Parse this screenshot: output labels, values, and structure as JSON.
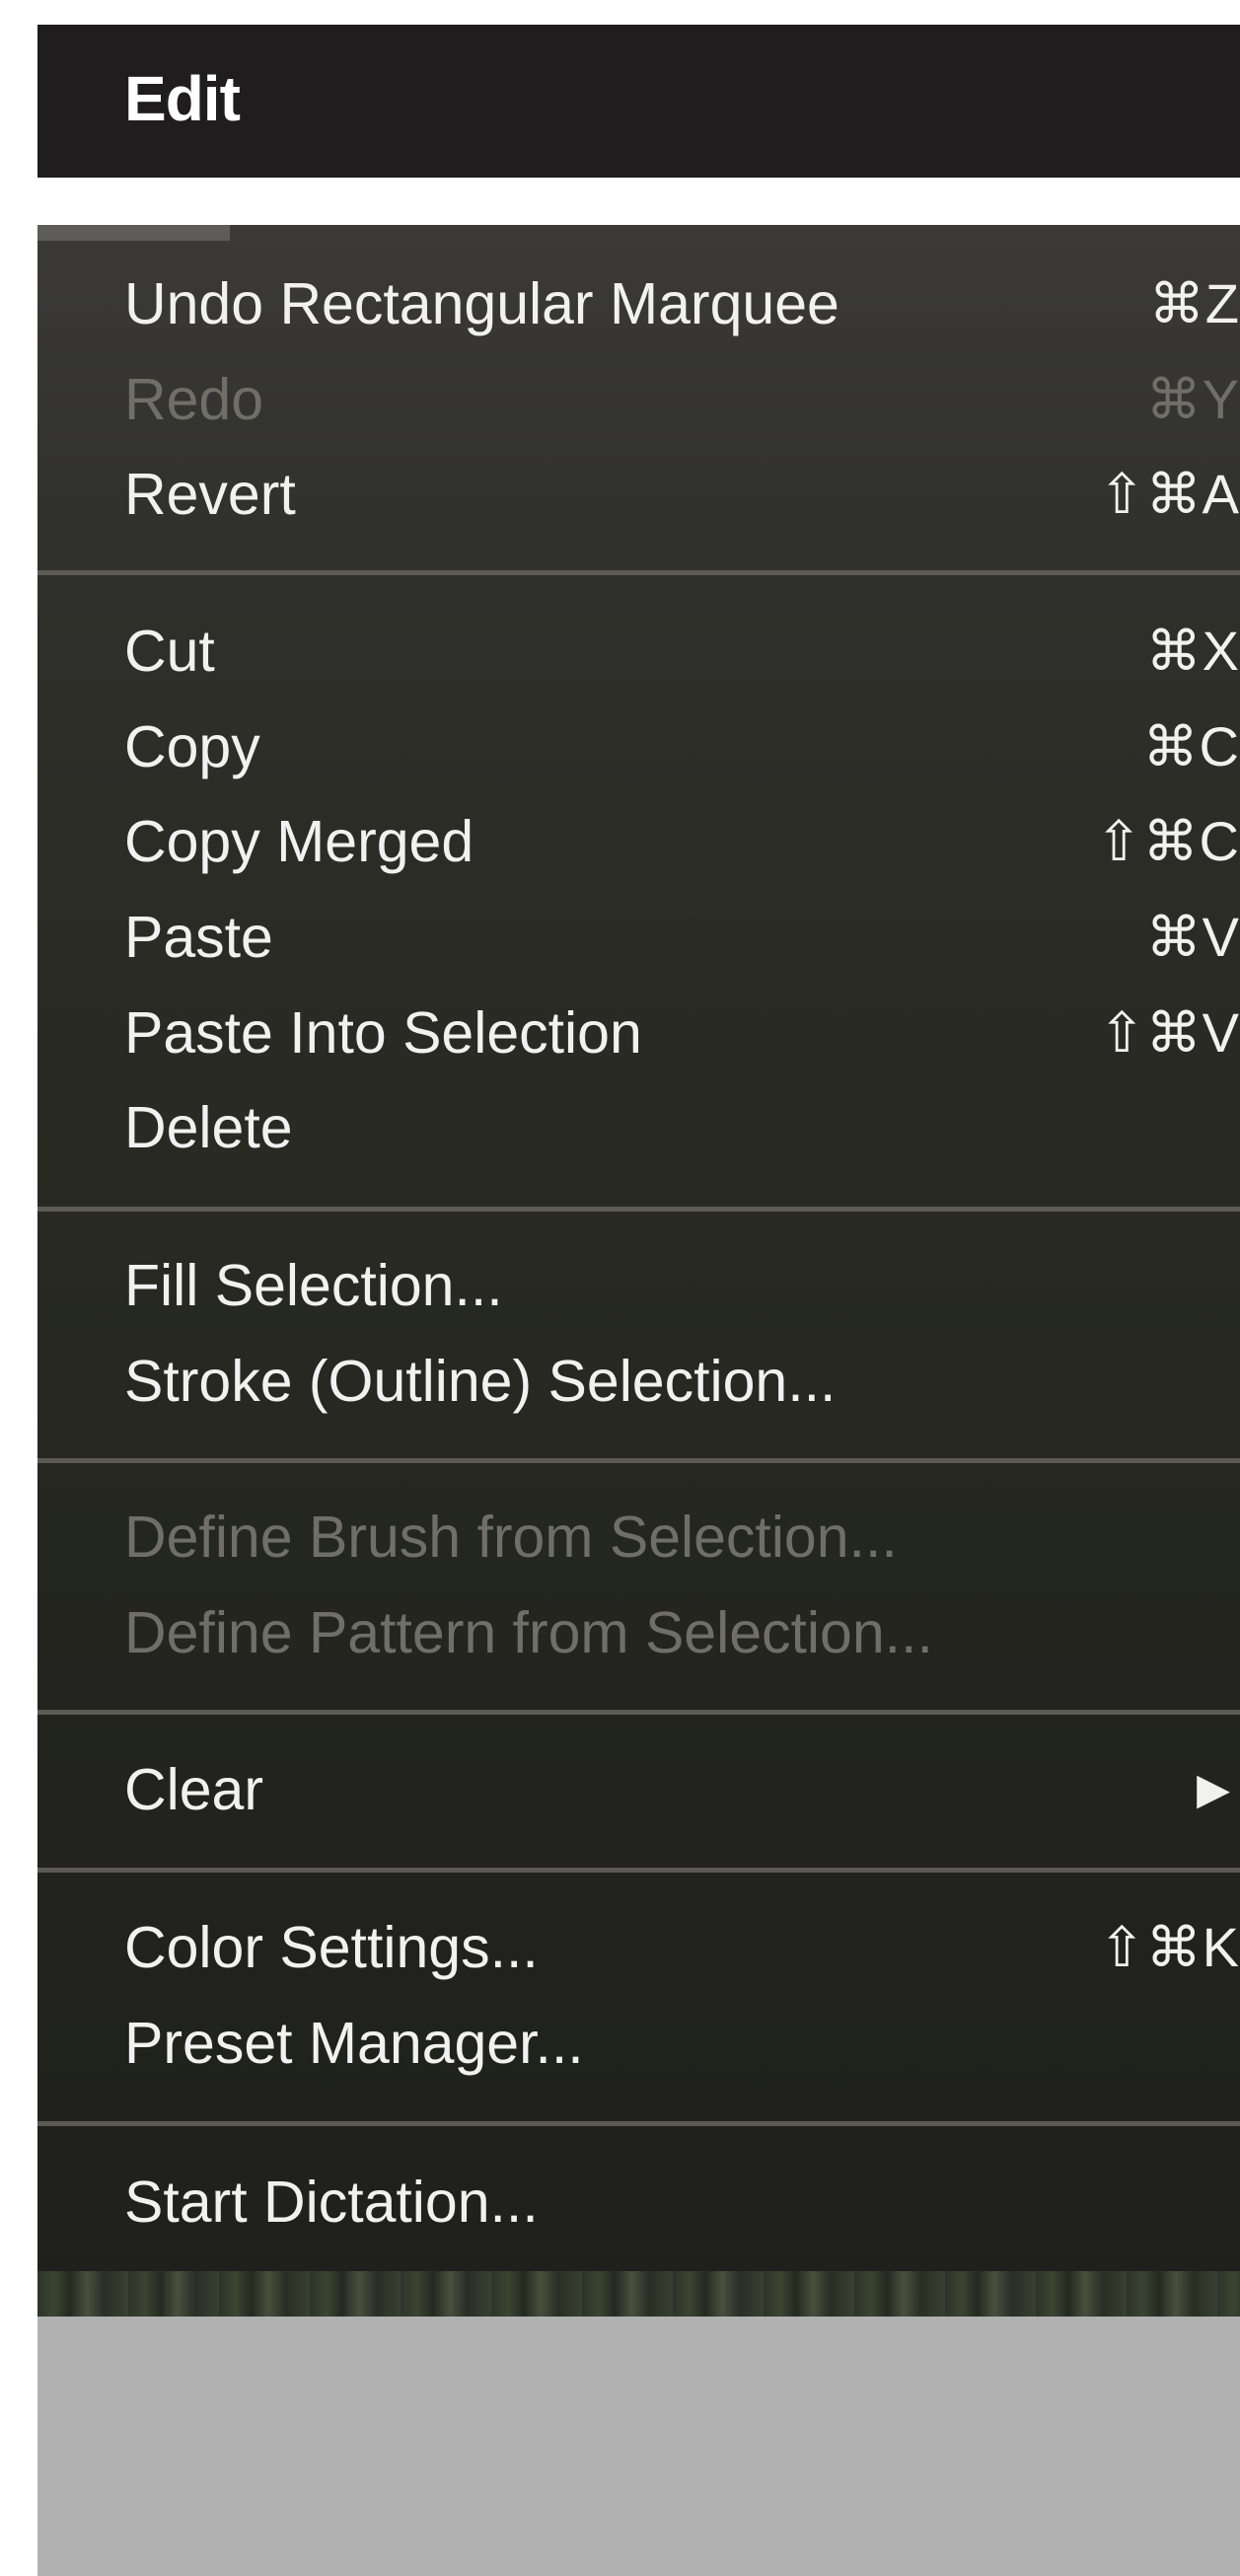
{
  "menu_bar": {
    "title": "Edit"
  },
  "menu": {
    "items": [
      {
        "label": "Undo Rectangular Marquee",
        "shortcut": "⌘Z",
        "disabled": false
      },
      {
        "label": "Redo",
        "shortcut": "⌘Y",
        "disabled": true
      },
      {
        "label": "Revert",
        "shortcut": "⇧⌘A",
        "disabled": false
      },
      {
        "label": "Cut",
        "shortcut": "⌘X",
        "disabled": false
      },
      {
        "label": "Copy",
        "shortcut": "⌘C",
        "disabled": false
      },
      {
        "label": "Copy Merged",
        "shortcut": "⇧⌘C",
        "disabled": false
      },
      {
        "label": "Paste",
        "shortcut": "⌘V",
        "disabled": false
      },
      {
        "label": "Paste Into Selection",
        "shortcut": "⇧⌘V",
        "disabled": false
      },
      {
        "label": "Delete",
        "shortcut": "",
        "disabled": false
      },
      {
        "label": "Fill Selection...",
        "shortcut": "",
        "disabled": false
      },
      {
        "label": "Stroke (Outline) Selection...",
        "shortcut": "",
        "disabled": false
      },
      {
        "label": "Define Brush from Selection...",
        "shortcut": "",
        "disabled": true
      },
      {
        "label": "Define Pattern from Selection...",
        "shortcut": "",
        "disabled": true
      },
      {
        "label": "Clear",
        "shortcut": "",
        "submenu_icon": "play-arrow-icon",
        "arrow": "▶",
        "disabled": false
      },
      {
        "label": "Color Settings...",
        "shortcut": "⇧⌘K",
        "disabled": false
      },
      {
        "label": "Preset Manager...",
        "shortcut": "",
        "disabled": false
      },
      {
        "label": "Start Dictation...",
        "shortcut": "",
        "disabled": false
      }
    ]
  },
  "colors": {
    "menu_bar_background": "#1f1d1e",
    "menu_text": "#f1f1f0",
    "disabled_text": "#6f6f68",
    "separator": "#5b5a55",
    "bottom_panel": "#b2b1b2"
  }
}
